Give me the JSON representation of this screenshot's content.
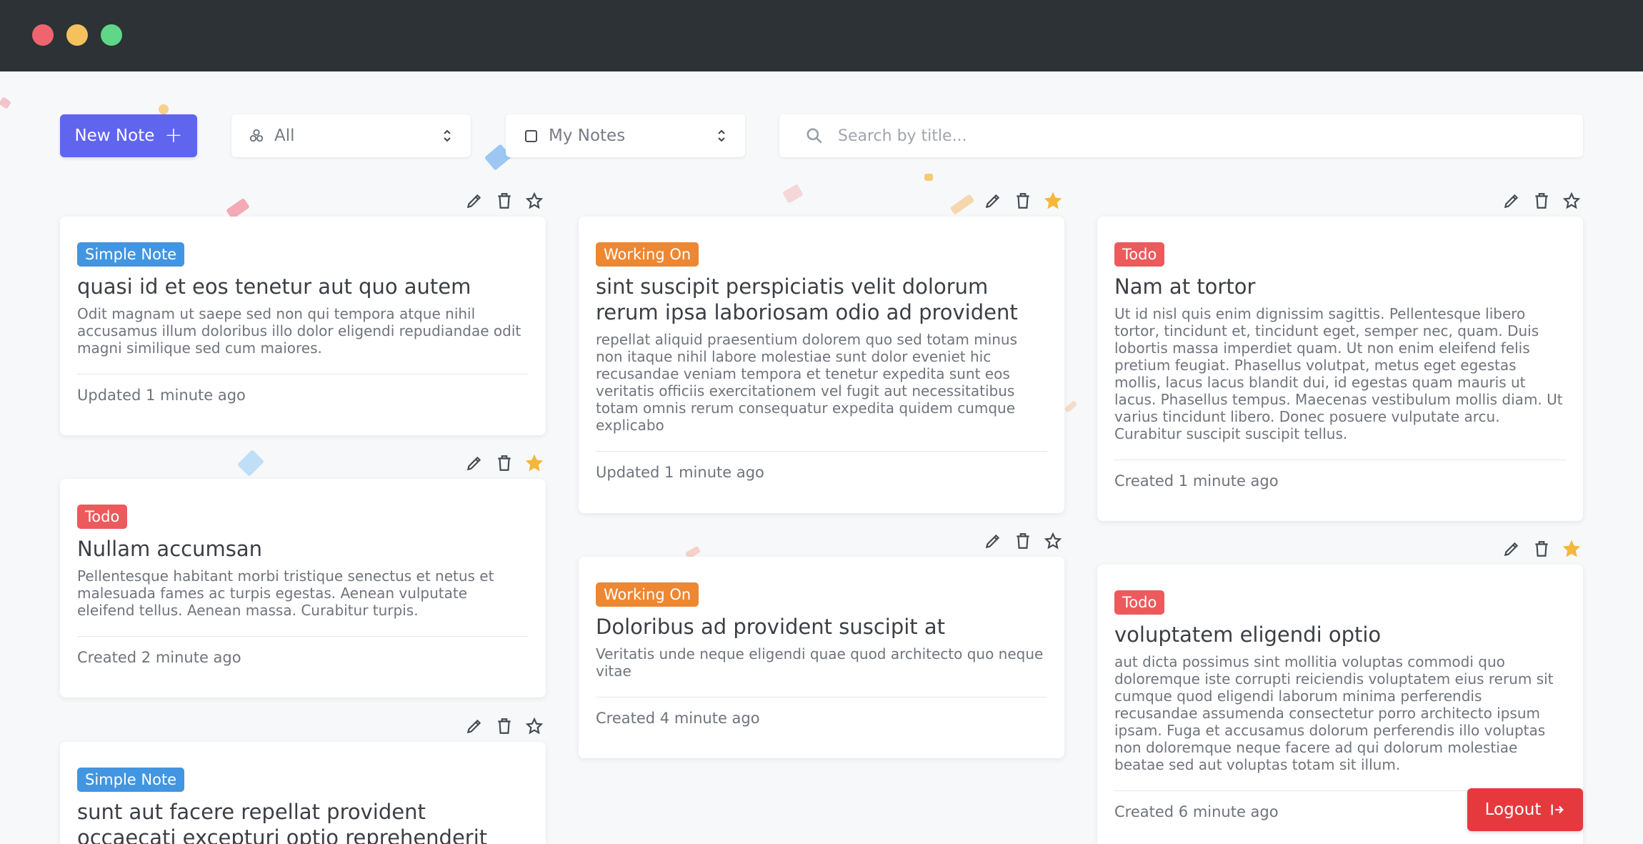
{
  "window": {
    "controls": [
      "close",
      "minimize",
      "maximize"
    ],
    "colors": {
      "close": "#f06470",
      "minimize": "#f4c15d",
      "maximize": "#5fd786",
      "titlebar": "#2c3236"
    }
  },
  "toolbar": {
    "new_note_label": "New Note",
    "category_filter": {
      "selected": "All",
      "icon": "category-icon"
    },
    "owner_filter": {
      "selected": "My Notes",
      "icon": "checkbox-icon"
    },
    "search": {
      "placeholder": "Search by title...",
      "value": ""
    }
  },
  "colors": {
    "accent": "#6065f0",
    "simple_note": "#4295e0",
    "working_on": "#ee8732",
    "todo": "#ec5a5c",
    "logout": "#e6393e",
    "starred": "#f5b73b"
  },
  "notes": [
    {
      "tag": "Simple Note",
      "title": "quasi id et eos tenetur aut quo autem",
      "body": "Odit magnam ut saepe sed non qui tempora atque nihil accusamus illum doloribus illo dolor eligendi repudiandae odit magni similique sed cum maiores.",
      "footer": "Updated 1 minute ago",
      "starred": false
    },
    {
      "tag": "Todo",
      "title": "Nullam accumsan",
      "body": "Pellentesque habitant morbi tristique senectus et netus et malesuada fames ac turpis egestas. Aenean vulputate eleifend tellus. Aenean massa. Curabitur turpis.",
      "footer": "Created 2 minute ago",
      "starred": true
    },
    {
      "tag": "Simple Note",
      "title": "sunt aut facere repellat provident occaecati excepturi optio reprehenderit",
      "body": "",
      "footer": "",
      "starred": false
    },
    {
      "tag": "Working On",
      "title": "sint suscipit perspiciatis velit dolorum rerum ipsa laboriosam odio ad provident",
      "body": "repellat aliquid praesentium dolorem quo sed totam minus non itaque nihil labore molestiae sunt dolor eveniet hic recusandae veniam tempora et tenetur expedita sunt eos veritatis officiis exercitationem vel fugit aut necessitatibus totam omnis rerum consequatur expedita quidem cumque explicabo",
      "footer": "Updated 1 minute ago",
      "starred": true
    },
    {
      "tag": "Working On",
      "title": "Doloribus ad provident suscipit at",
      "body": "Veritatis unde neque eligendi quae quod architecto quo neque vitae",
      "footer": "Created 4 minute ago",
      "starred": false
    },
    {
      "tag": "Todo",
      "title": "Nam at tortor",
      "body": "Ut id nisl quis enim dignissim sagittis. Pellentesque libero tortor, tincidunt et, tincidunt eget, semper nec, quam. Duis lobortis massa imperdiet quam. Ut non enim eleifend felis pretium feugiat. Phasellus volutpat, metus eget egestas mollis, lacus lacus blandit dui, id egestas quam mauris ut lacus. Phasellus tempus. Maecenas vestibulum mollis diam. Ut varius tincidunt libero. Donec posuere vulputate arcu. Curabitur suscipit suscipit tellus.",
      "footer": "Created 1 minute ago",
      "starred": false
    },
    {
      "tag": "Todo",
      "title": "voluptatem eligendi optio",
      "body": "aut dicta possimus sint mollitia voluptas commodi quo doloremque iste corrupti reiciendis voluptatem eius rerum sit cumque quod eligendi laborum minima perferendis recusandae assumenda consectetur porro architecto ipsum ipsam. Fuga et accusamus dolorum perferendis illo voluptas non doloremque neque facere ad qui dolorum molestiae beatae sed aut voluptas totam sit illum.",
      "footer": "Created 6 minute ago",
      "starred": true
    }
  ],
  "logout_label": "Logout"
}
